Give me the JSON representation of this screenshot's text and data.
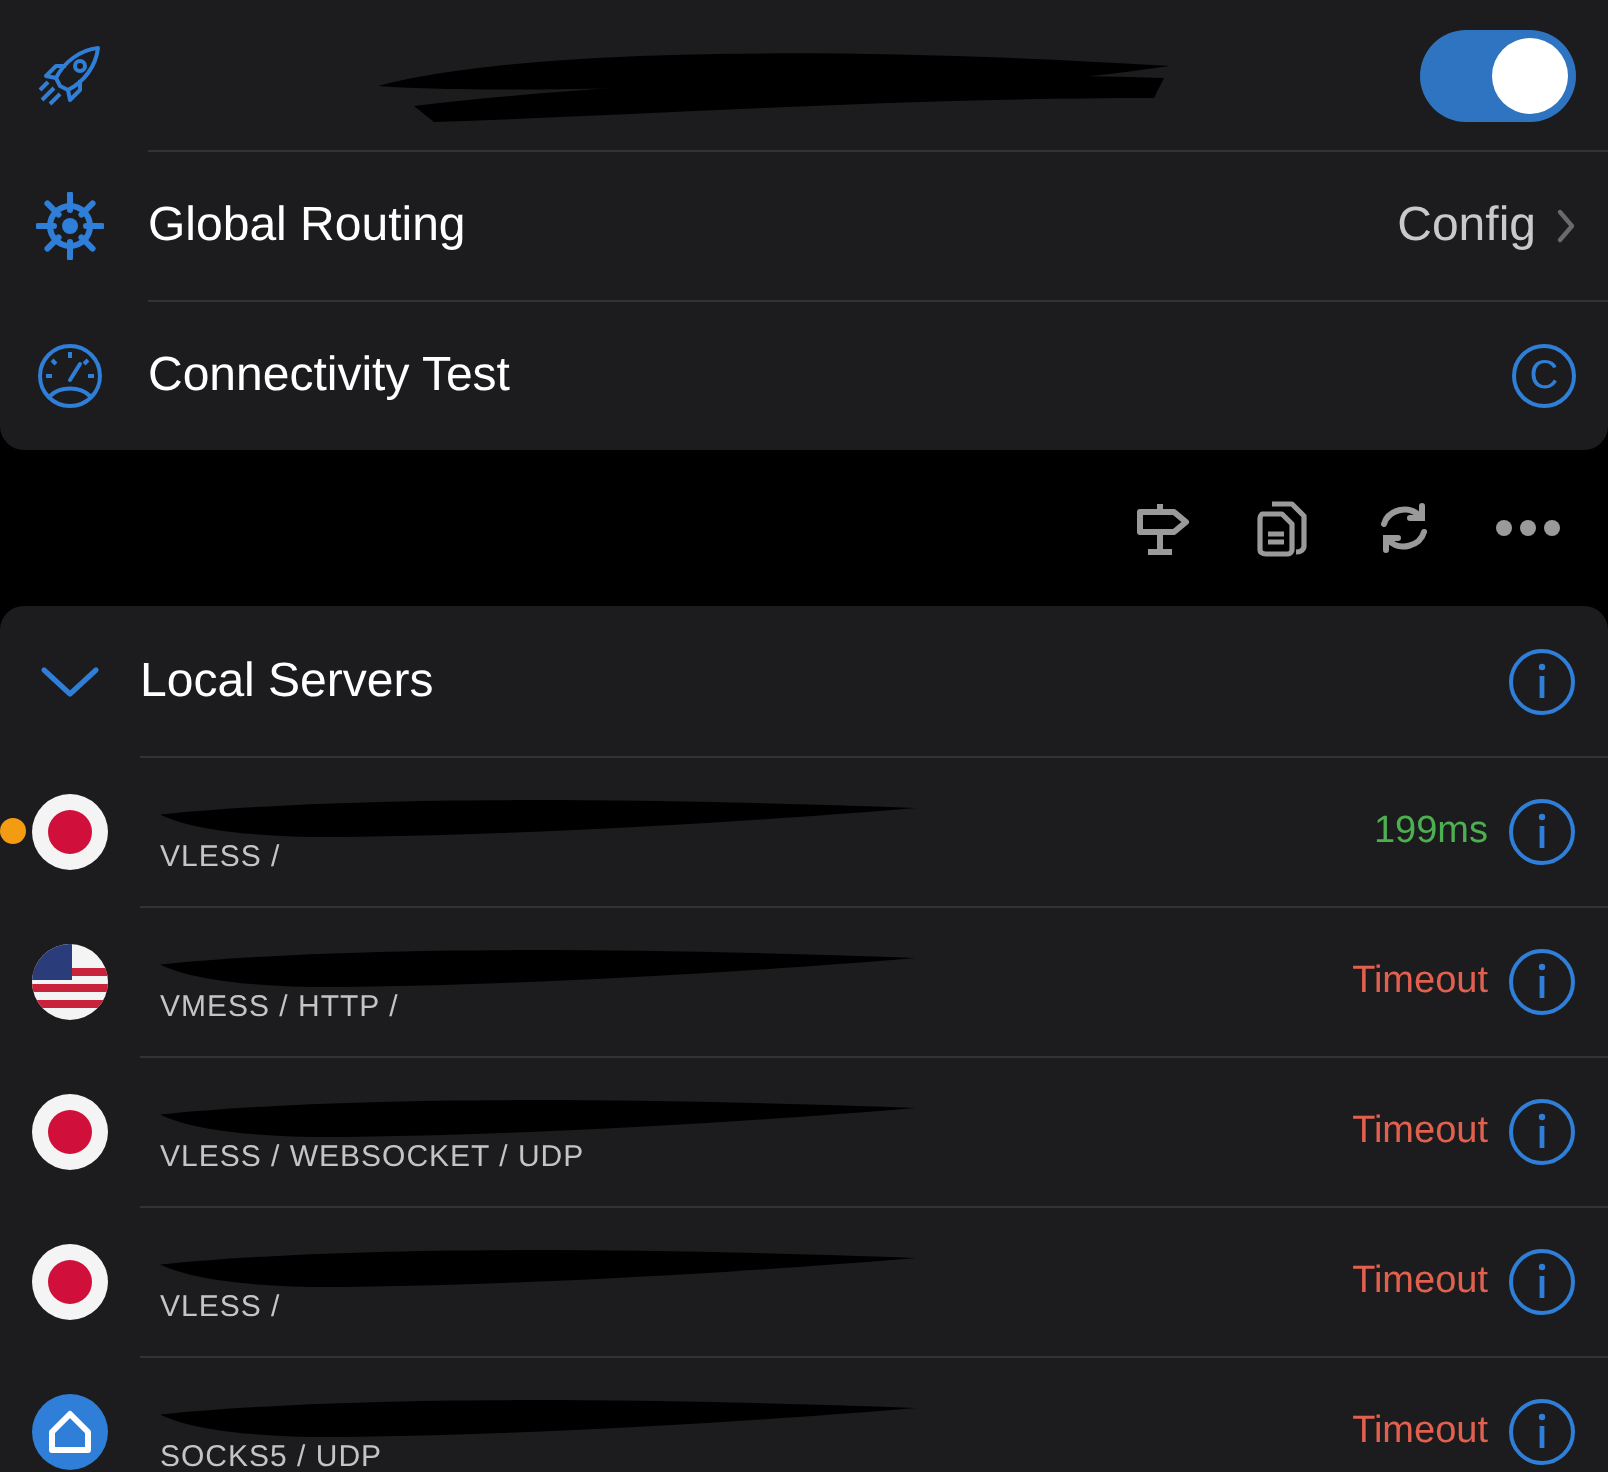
{
  "settings": [
    {
      "kind": "toggle",
      "on": true
    },
    {
      "kind": "link",
      "label": "Global Routing",
      "value": "Config"
    },
    {
      "kind": "badge",
      "label": "Connectivity Test",
      "badge": "C"
    }
  ],
  "group": {
    "title": "Local Servers",
    "expanded": true
  },
  "servers": [
    {
      "kind": "jp",
      "selected": true,
      "protocol": "VLESS /",
      "latency": "199ms",
      "color": "#4caf50"
    },
    {
      "kind": "us",
      "selected": false,
      "protocol": "VMESS / HTTP /",
      "latency": "Timeout",
      "color": "#e2604e"
    },
    {
      "kind": "jp",
      "selected": false,
      "protocol": "VLESS / WEBSOCKET / UDP",
      "latency": "Timeout",
      "color": "#e2604e"
    },
    {
      "kind": "jp",
      "selected": false,
      "protocol": "VLESS /",
      "latency": "Timeout",
      "color": "#e2604e"
    },
    {
      "kind": "home",
      "selected": false,
      "protocol": "SOCKS5 / UDP",
      "latency": "Timeout",
      "color": "#e2604e"
    }
  ]
}
